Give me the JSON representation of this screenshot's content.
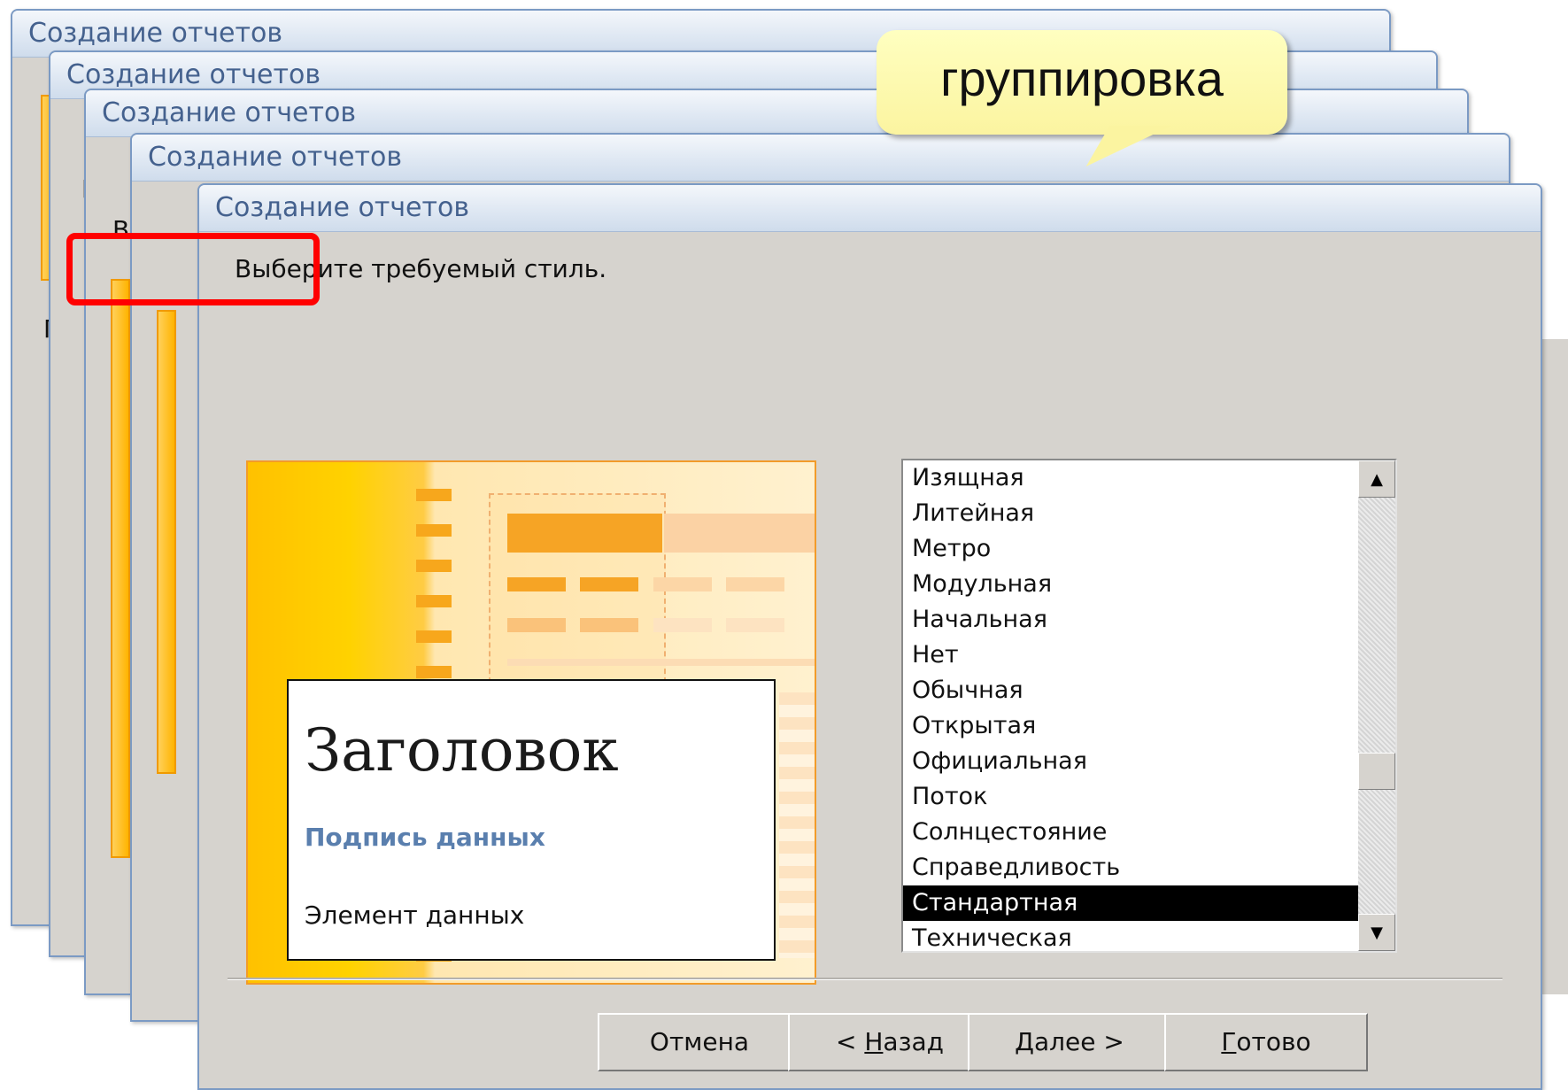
{
  "window_title": "Создание отчетов",
  "back_fragments": {
    "f1": "В",
    "f2": "В",
    "f3": "Г"
  },
  "prompt": "Выберите требуемый стиль.",
  "preview": {
    "title": "Заголовок",
    "subtitle": "Подпись данных",
    "item": "Элемент данных"
  },
  "styles": [
    "Изящная",
    "Литейная",
    "Метро",
    "Модульная",
    "Начальная",
    "Нет",
    "Обычная",
    "Открытая",
    "Официальная",
    "Поток",
    "Солнцестояние",
    "Справедливость",
    "Стандартная",
    "Техническая"
  ],
  "selected_style": "Стандартная",
  "scroll_up_glyph": "▲",
  "scroll_down_glyph": "▼",
  "buttons": {
    "cancel": "Отмена",
    "back_prefix": "< ",
    "back_key": "Н",
    "back_rest": "азад",
    "next_key": "Д",
    "next_rest": "алее >",
    "finish_key": "Г",
    "finish_rest": "отово"
  },
  "callout": "группировка",
  "colors": {
    "accent_red": "#ff0000",
    "callout_bg": "#ffffc0",
    "title_text": "#44618e"
  }
}
